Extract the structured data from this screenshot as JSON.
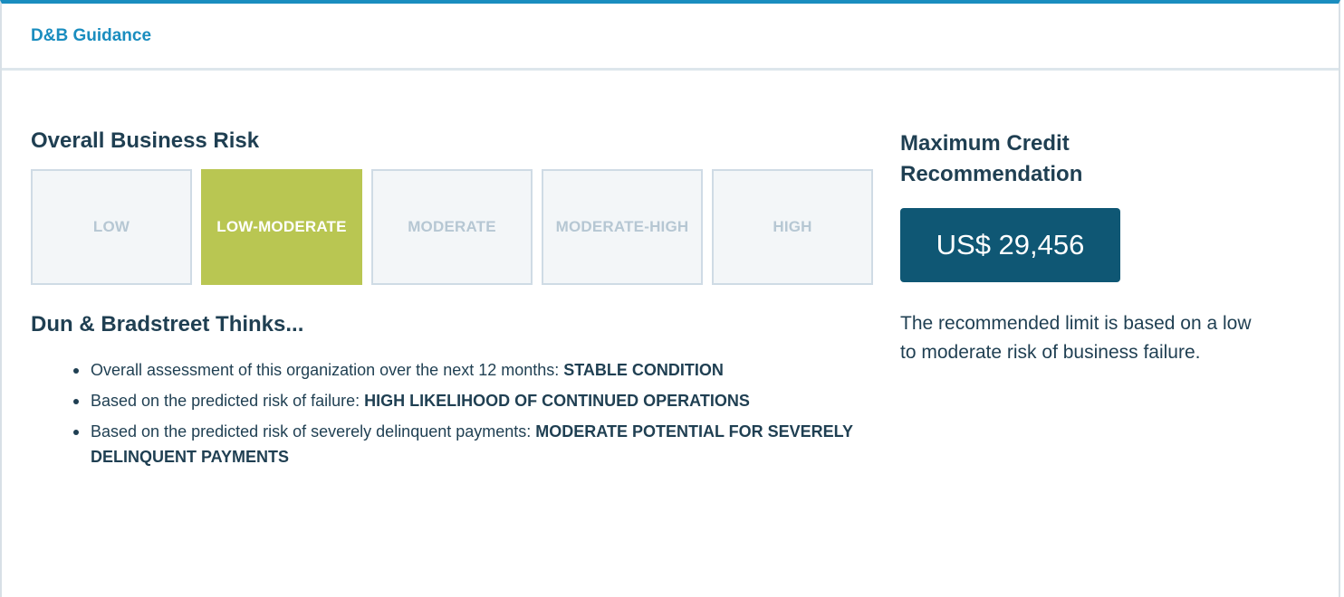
{
  "panel": {
    "title": "D&B Guidance"
  },
  "risk": {
    "title": "Overall Business Risk",
    "levels": [
      {
        "label": "LOW",
        "active": false
      },
      {
        "label": "LOW-MODERATE",
        "active": true
      },
      {
        "label": "MODERATE",
        "active": false
      },
      {
        "label": "MODERATE-HIGH",
        "active": false
      },
      {
        "label": "HIGH",
        "active": false
      }
    ],
    "active_color": "#b9c652",
    "inactive_color": "#f3f6f8"
  },
  "thinks": {
    "title": "Dun & Bradstreet Thinks...",
    "items": [
      {
        "text": "Overall assessment of this organization over the next 12 months: ",
        "emphasis": "STABLE CONDITION"
      },
      {
        "text": "Based on the predicted risk of failure: ",
        "emphasis": "HIGH LIKELIHOOD OF CONTINUED OPERATIONS"
      },
      {
        "text": "Based on the predicted risk of severely delinquent payments: ",
        "emphasis": "MODERATE POTENTIAL FOR SEVERELY DELINQUENT PAYMENTS"
      }
    ]
  },
  "credit": {
    "title": "Maximum Credit Recommendation",
    "value": "US$ 29,456",
    "note": "The recommended limit is based on a low to moderate risk of business failure.",
    "box_color": "#0f5774"
  },
  "colors": {
    "accent": "#1a8dbf",
    "text": "#1f3f52"
  }
}
